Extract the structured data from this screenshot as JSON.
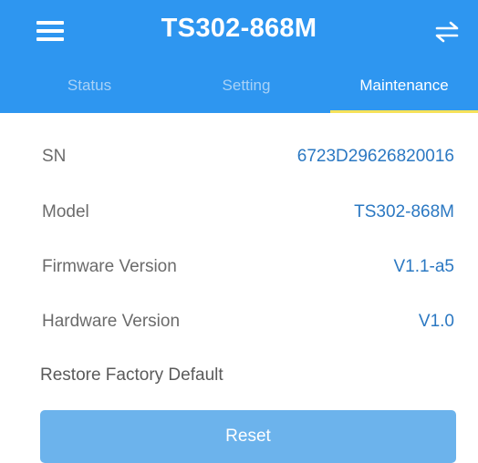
{
  "header": {
    "title": "TS302-868M",
    "menu_icon": "hamburger-menu-icon",
    "switch_icon": "swap-arrows-icon"
  },
  "tabs": [
    {
      "label": "Status",
      "active": false
    },
    {
      "label": "Setting",
      "active": false
    },
    {
      "label": "Maintenance",
      "active": true
    }
  ],
  "info": {
    "sn": {
      "label": "SN",
      "value": "6723D29626820016"
    },
    "model": {
      "label": "Model",
      "value": "TS302-868M"
    },
    "firmware": {
      "label": "Firmware Version",
      "value": "V1.1-a5"
    },
    "hardware": {
      "label": "Hardware Version",
      "value": "V1.0"
    }
  },
  "restore": {
    "label": "Restore Factory Default",
    "button_label": "Reset"
  },
  "colors": {
    "primary": "#2e96f0",
    "tab_indicator": "#f6e25a",
    "value_text": "#2b78c2",
    "button": "#6cb3ec"
  }
}
